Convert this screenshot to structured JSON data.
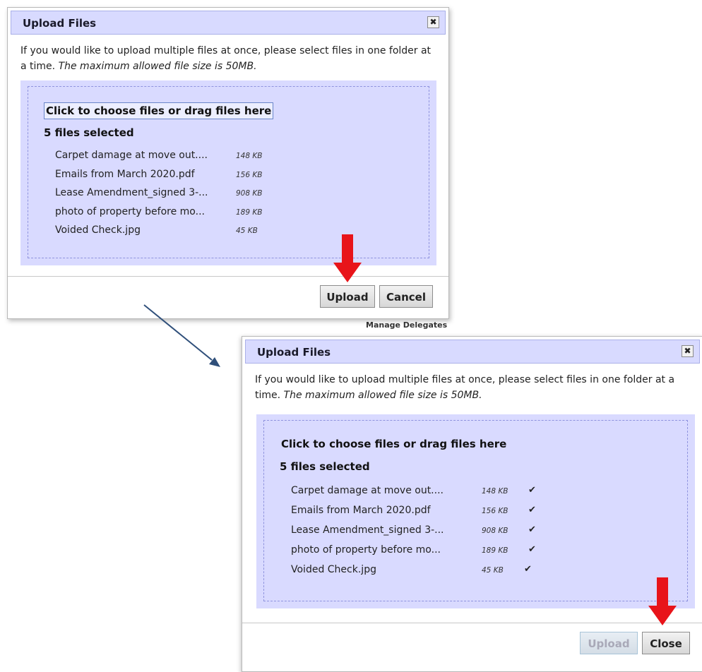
{
  "dialogs": [
    {
      "title": "Upload Files",
      "intro_text": "If you would like to upload multiple files at once, please select files in one folder at a time.",
      "intro_italic": "The maximum allowed file size is 50MB.",
      "choose_label": "Click to choose files or drag files here",
      "count_label": "5 files selected",
      "files": [
        {
          "name": "Carpet damage at move out....",
          "size": "148 KB"
        },
        {
          "name": "Emails from March 2020.pdf",
          "size": "156 KB"
        },
        {
          "name": "Lease Amendment_signed 3-...",
          "size": "908 KB"
        },
        {
          "name": "photo of property before mo...",
          "size": "189 KB"
        },
        {
          "name": "Voided Check.jpg",
          "size": "45 KB"
        }
      ],
      "buttons": {
        "primary": "Upload",
        "secondary": "Cancel"
      },
      "close_glyph": "✖"
    },
    {
      "title": "Upload Files",
      "intro_text": "If you would like to upload multiple files at once, please select files in one folder at a time.",
      "intro_italic": "The maximum allowed file size is 50MB.",
      "choose_label": "Click to choose files or drag files here",
      "count_label": "5 files selected",
      "files": [
        {
          "name": "Carpet damage at move out....",
          "size": "148 KB",
          "status": "✔"
        },
        {
          "name": "Emails from March 2020.pdf",
          "size": "156 KB",
          "status": "✔"
        },
        {
          "name": "Lease Amendment_signed 3-...",
          "size": "908 KB",
          "status": "✔"
        },
        {
          "name": "photo of property before mo...",
          "size": "189 KB",
          "status": "✔"
        },
        {
          "name": "Voided Check.jpg",
          "size": "45 KB",
          "status": "✔"
        }
      ],
      "buttons": {
        "primary": "Upload",
        "secondary": "Close"
      },
      "close_glyph": "✖"
    }
  ],
  "background_partial_text": "Manage Delegates",
  "colors": {
    "accent_arrow": "#e8141a",
    "connector": "#2f4f7a",
    "titlebar": "#d8daff",
    "dropzone": "#d9daff"
  },
  "icons": [
    "close-icon",
    "check-icon",
    "red-down-arrow-icon",
    "connector-arrow-icon"
  ]
}
